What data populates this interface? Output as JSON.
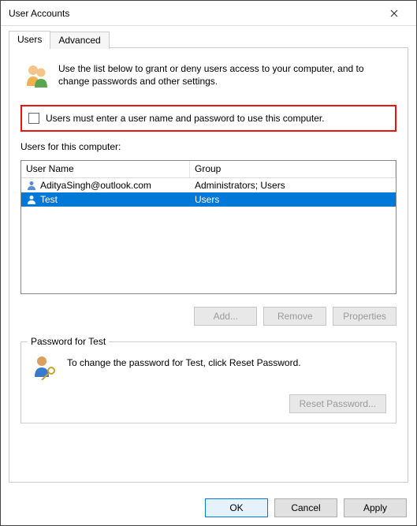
{
  "window": {
    "title": "User Accounts"
  },
  "tabs": {
    "users": "Users",
    "advanced": "Advanced"
  },
  "intro": "Use the list below to grant or deny users access to your computer, and to change passwords and other settings.",
  "checkbox_label": "Users must enter a user name and password to use this computer.",
  "users_label": "Users for this computer:",
  "columns": {
    "name": "User Name",
    "group": "Group"
  },
  "rows": [
    {
      "name": "AdityaSingh@outlook.com",
      "group": "Administrators; Users",
      "selected": false
    },
    {
      "name": "Test",
      "group": "Users",
      "selected": true
    }
  ],
  "buttons": {
    "add": "Add...",
    "remove": "Remove",
    "properties": "Properties"
  },
  "password_group": {
    "legend": "Password for Test",
    "text": "To change the password for Test, click Reset Password.",
    "reset": "Reset Password..."
  },
  "footer": {
    "ok": "OK",
    "cancel": "Cancel",
    "apply": "Apply"
  }
}
